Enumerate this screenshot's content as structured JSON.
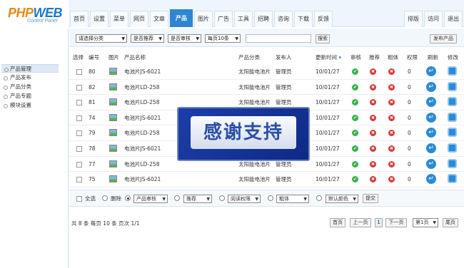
{
  "logo": {
    "brand_a": "PHP",
    "brand_b": "WEB",
    "tag": "Control Panel"
  },
  "nav": {
    "tabs": [
      "首页",
      "设置",
      "菜单",
      "网页",
      "文章",
      "产品",
      "图片",
      "广告",
      "工具",
      "招聘",
      "咨询",
      "下载",
      "反馈"
    ],
    "active": "产品",
    "right": [
      "排版",
      "访问",
      "退出"
    ]
  },
  "sidebar": {
    "items": [
      "产品管理",
      "产品发布",
      "产品分类",
      "产品专题",
      "模块设置"
    ],
    "active": "产品管理"
  },
  "filters": {
    "category": "请选择分类",
    "recommend": "是否推荐",
    "review": "是否审核",
    "perpage": "每页10条",
    "search_value": "",
    "search_btn": "搜索",
    "publish_btn": "发布产品"
  },
  "table": {
    "headers": {
      "select": "选择",
      "id": "编号",
      "pic": "图片",
      "name": "产品名称",
      "cat": "产品分类",
      "author": "发布人",
      "time": "更新时间",
      "review": "审核",
      "rec": "推荐",
      "bold": "粗体",
      "perm": "权限",
      "refresh": "刷新",
      "edit": "修改"
    },
    "rows": [
      {
        "id": "80",
        "name": "电池片JS-6021",
        "cat": "太阳能电池片",
        "author": "管理员",
        "time": "10/01/27",
        "perm": "0"
      },
      {
        "id": "82",
        "name": "电池片LD-258",
        "cat": "太阳能电池片",
        "author": "管理员",
        "time": "10/01/27",
        "perm": "0"
      },
      {
        "id": "81",
        "name": "电池片LD-258",
        "cat": "太阳能电池片",
        "author": "管理员",
        "time": "10/01/27",
        "perm": "0"
      },
      {
        "id": "74",
        "name": "电池片JS-6021",
        "cat": "太阳能电池片",
        "author": "管理员",
        "time": "10/01/27",
        "perm": "0"
      },
      {
        "id": "79",
        "name": "电池片LD-258",
        "cat": "太阳能电池片",
        "author": "管理员",
        "time": "10/01/27",
        "perm": "0"
      },
      {
        "id": "78",
        "name": "电池片JS-6021",
        "cat": "太阳能电池片",
        "author": "管理员",
        "time": "10/01/27",
        "perm": "0"
      },
      {
        "id": "77",
        "name": "电池片LD-258",
        "cat": "太阳能电池片",
        "author": "管理员",
        "time": "10/01/27",
        "perm": "0"
      },
      {
        "id": "75",
        "name": "电池片JS-6021",
        "cat": "太阳能电池片",
        "author": "管理员",
        "time": "10/01/27",
        "perm": "0"
      }
    ]
  },
  "bulk": {
    "select_all": "全选",
    "delete": "删除",
    "review": "产品审核",
    "recommend": "推荐",
    "perm": "阅读权限",
    "bold": "粗体",
    "color": "默认颜色",
    "submit": "提交"
  },
  "pager": {
    "summary": "共 8 条 每页 10 条 页次 1/1",
    "first": "首页",
    "prev": "上一页",
    "current": "1",
    "next": "下一页",
    "page_select": "第1页",
    "last": "尾页"
  },
  "overlay": {
    "text": "感谢支持"
  },
  "colors": {
    "accent": "#2f86d0",
    "ok": "#36b34a",
    "no": "#d6393a"
  }
}
